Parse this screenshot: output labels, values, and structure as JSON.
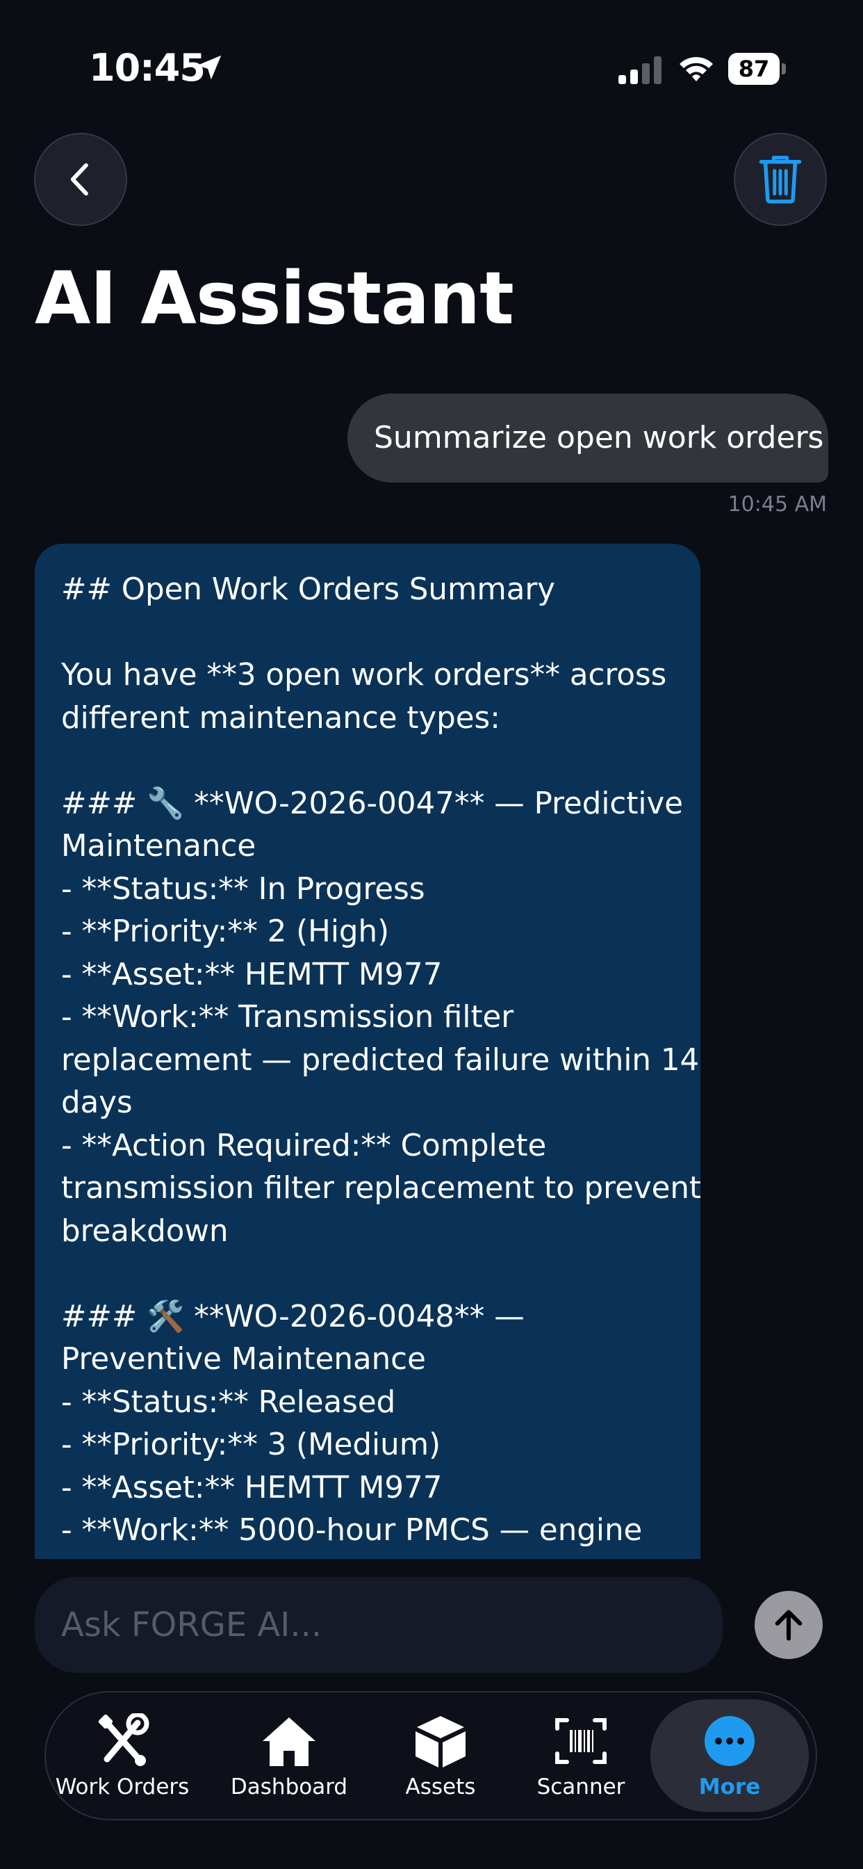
{
  "status_bar": {
    "time": "10:45",
    "battery": "87"
  },
  "header": {
    "title": "AI Assistant"
  },
  "conversation": {
    "user_message": {
      "text": "Summarize open work orders",
      "timestamp": "10:45 AM"
    },
    "assistant_message": {
      "lines": [
        "## Open Work Orders Summary",
        "",
        "You have **3 open work orders** across",
        "different maintenance types:",
        "",
        "### 🔧 **WO-2026-0047** — Predictive",
        "Maintenance",
        "- **Status:** In Progress",
        "- **Priority:** 2 (High)",
        "- **Asset:** HEMTT M977",
        "- **Work:** Transmission filter",
        "replacement — predicted failure within 14",
        "days",
        "- **Action Required:** Complete",
        "transmission filter replacement to prevent",
        "breakdown",
        "",
        "### 🛠️ **WO-2026-0048** —",
        "Preventive Maintenance",
        "- **Status:** Released",
        "- **Priority:** 3 (Medium)",
        "- **Asset:** HEMTT M977",
        "- **Work:** 5000-hour PMCS — engine"
      ]
    }
  },
  "composer": {
    "placeholder": "Ask FORGE AI..."
  },
  "tab_bar": {
    "tabs": [
      {
        "label": "Work Orders",
        "icon": "wrench-screwdriver-icon"
      },
      {
        "label": "Dashboard",
        "icon": "house-icon"
      },
      {
        "label": "Assets",
        "icon": "cube-icon"
      },
      {
        "label": "Scanner",
        "icon": "barcode-scan-icon"
      },
      {
        "label": "More",
        "icon": "ellipsis-circle-icon",
        "active": true
      }
    ]
  },
  "colors": {
    "accent": "#1e9bf0",
    "assistant_bubble": "#0a3257",
    "user_bubble": "#33353d",
    "background": "#0b0d15"
  }
}
